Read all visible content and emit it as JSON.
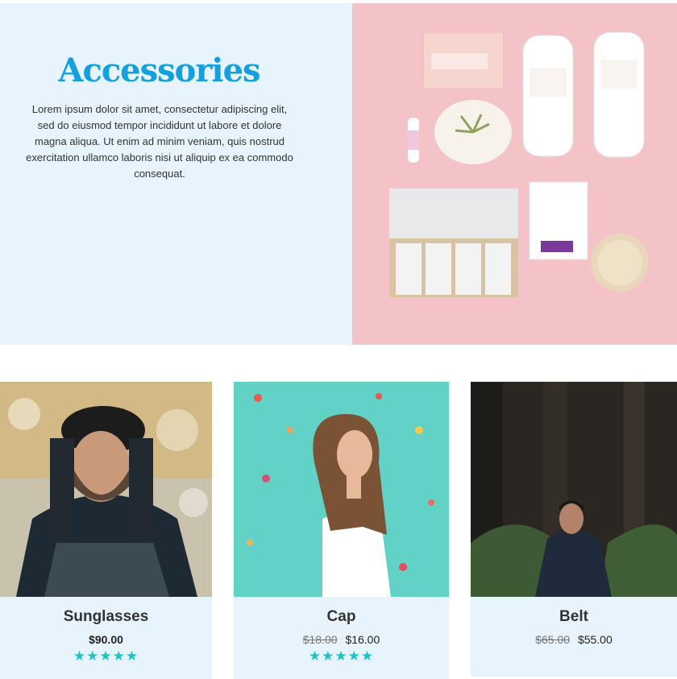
{
  "hero": {
    "title": "Accessories",
    "description": "Lorem ipsum dolor sit amet, consectetur adipiscing elit, sed do eiusmod tempor incididunt ut labore et dolore magna aliqua. Ut enim ad minim veniam, quis nostrud exercitation ullamco laboris nisi ut aliquip ex ea commodo consequat."
  },
  "products": [
    {
      "name": "Sunglasses",
      "price": "$90.00",
      "old_price": "",
      "stars": "★★★★★",
      "rating": 5
    },
    {
      "name": "Cap",
      "price": "$16.00",
      "old_price": "$18.00",
      "stars": "★★★★★",
      "rating": 5
    },
    {
      "name": "Belt",
      "price": "$55.00",
      "old_price": "$65.00",
      "stars": "",
      "rating": null
    }
  ],
  "colors": {
    "accent": "#12a1e0",
    "panel_bg": "#e8f4fd",
    "star": "#1fc2c9",
    "hero_image_bg": "#f3c3c8"
  }
}
